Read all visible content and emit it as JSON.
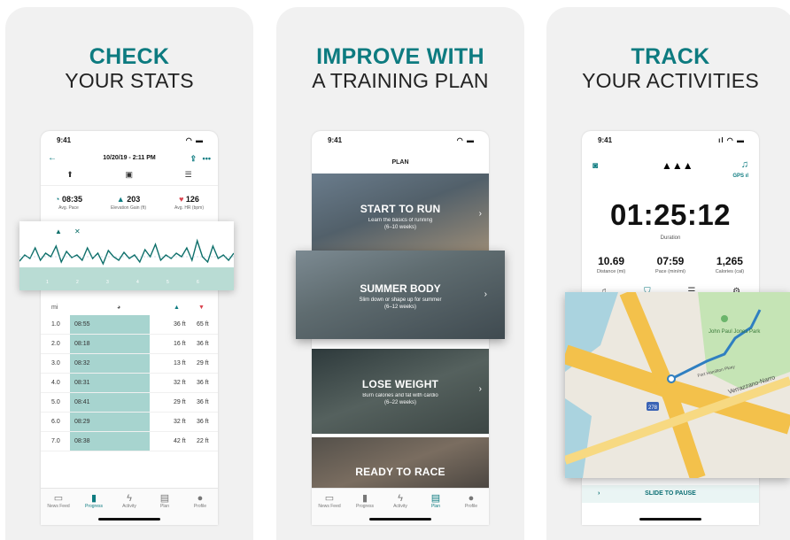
{
  "panels": [
    {
      "headline": "CHECK",
      "subline": "YOUR STATS"
    },
    {
      "headline": "IMPROVE WITH",
      "subline": "A TRAINING PLAN"
    },
    {
      "headline": "TRACK",
      "subline": "YOUR ACTIVITIES"
    }
  ],
  "status_time": "9:41",
  "stats_screen": {
    "date": "10/20/19 - 2:11 PM",
    "stats": [
      {
        "value": "08:35",
        "label": "Avg. Pace",
        "icon": "pace-icon"
      },
      {
        "value": "203",
        "label": "Elevation Gain (ft)",
        "icon": "mountain-icon"
      },
      {
        "value": "126",
        "label": "Avg. HR (bpm)",
        "icon": "heart-icon"
      }
    ],
    "table_unit": "mi",
    "splits": [
      {
        "mi": "1.0",
        "pace": "08:55",
        "gain": "36 ft",
        "loss": "65 ft"
      },
      {
        "mi": "2.0",
        "pace": "08:18",
        "gain": "16 ft",
        "loss": "36 ft"
      },
      {
        "mi": "3.0",
        "pace": "08:32",
        "gain": "13 ft",
        "loss": "29 ft"
      },
      {
        "mi": "4.0",
        "pace": "08:31",
        "gain": "32 ft",
        "loss": "36 ft"
      },
      {
        "mi": "5.0",
        "pace": "08:41",
        "gain": "29 ft",
        "loss": "36 ft"
      },
      {
        "mi": "6.0",
        "pace": "08:29",
        "gain": "32 ft",
        "loss": "36 ft"
      },
      {
        "mi": "7.0",
        "pace": "08:38",
        "gain": "42 ft",
        "loss": "22 ft"
      }
    ],
    "chart_markers": [
      "1",
      "2",
      "3",
      "4",
      "5",
      "6"
    ]
  },
  "plan_screen": {
    "title": "PLAN",
    "cards": [
      {
        "title": "START TO RUN",
        "sub1": "Learn the basics of running",
        "sub2": "(6–10 weeks)"
      },
      {
        "title": "SUMMER BODY",
        "sub1": "Slim down or shape up for summer",
        "sub2": "(6–12 weeks)"
      },
      {
        "title": "LOSE WEIGHT",
        "sub1": "Burn calories and fat with cardio",
        "sub2": "(6–22 weeks)"
      },
      {
        "title": "READY TO RACE",
        "sub1": "",
        "sub2": ""
      }
    ]
  },
  "track_screen": {
    "gps": "GPS",
    "duration": "01:25:12",
    "duration_label": "Duration",
    "metrics": [
      {
        "value": "10.69",
        "label": "Distance (mi)"
      },
      {
        "value": "07:59",
        "label": "Pace (min/mi)"
      },
      {
        "value": "1,265",
        "label": "Calories (cal)"
      }
    ],
    "slide_label": "SLIDE TO PAUSE",
    "map_labels": {
      "park": "John Paul Jones Park",
      "road1": "Fort Hamilton Pkwy",
      "road2": "Verrazzano-Narro",
      "shield": "278"
    }
  },
  "tabs": [
    {
      "label": "News Feed",
      "icon": "news-feed-icon"
    },
    {
      "label": "Progress",
      "icon": "progress-icon"
    },
    {
      "label": "Activity",
      "icon": "activity-icon"
    },
    {
      "label": "Plan",
      "icon": "plan-icon"
    },
    {
      "label": "Profile",
      "icon": "profile-icon"
    }
  ],
  "colors": {
    "accent": "#0d7b80",
    "heart": "#d9434e",
    "chart_fill": "#a7d4cf"
  }
}
